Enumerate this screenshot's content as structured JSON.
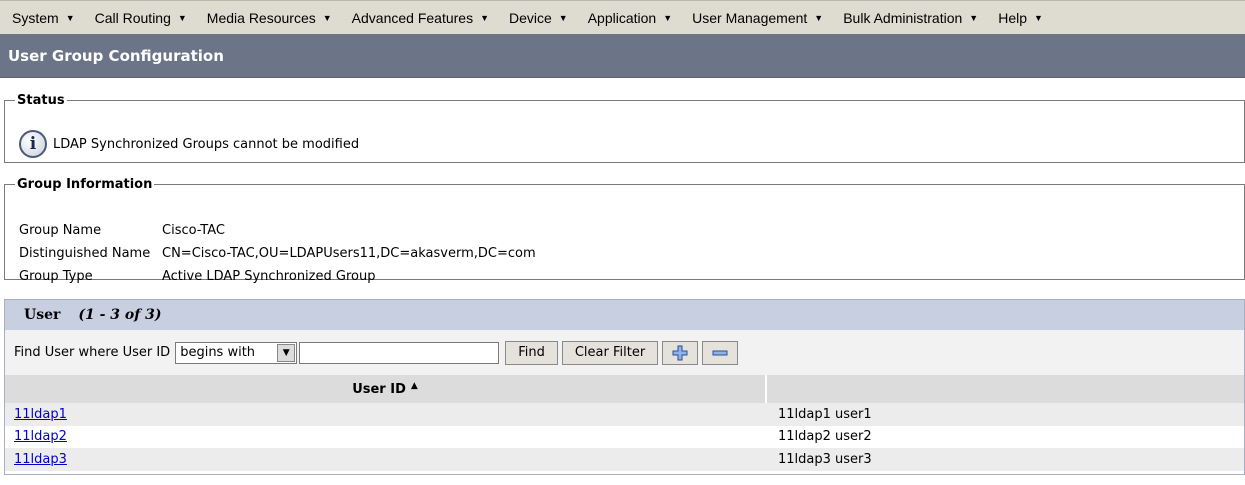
{
  "menu": [
    {
      "label": "System"
    },
    {
      "label": "Call Routing"
    },
    {
      "label": "Media Resources"
    },
    {
      "label": "Advanced Features"
    },
    {
      "label": "Device"
    },
    {
      "label": "Application"
    },
    {
      "label": "User Management"
    },
    {
      "label": "Bulk Administration"
    },
    {
      "label": "Help"
    }
  ],
  "page_title": "User Group Configuration",
  "status": {
    "legend": "Status",
    "icon": "info-icon",
    "message": "LDAP Synchronized Groups cannot be modified"
  },
  "group_info": {
    "legend": "Group Information",
    "rows": [
      {
        "label": "Group Name",
        "value": "Cisco-TAC"
      },
      {
        "label": "Distinguished Name",
        "value": "CN=Cisco-TAC,OU=LDAPUsers11,DC=akasverm,DC=com"
      },
      {
        "label": "Group Type",
        "value": "Active LDAP Synchronized Group"
      }
    ]
  },
  "user_panel": {
    "title": "User",
    "count": "(1 - 3 of 3)",
    "filter_label": "Find User where User ID",
    "filter_select": "begins with",
    "filter_value": "",
    "find_label": "Find",
    "clear_label": "Clear Filter",
    "column_header": "User ID",
    "rows": [
      {
        "user_id": "11ldap1",
        "name": "11ldap1 user1"
      },
      {
        "user_id": "11ldap2",
        "name": "11ldap2 user2"
      },
      {
        "user_id": "11ldap3",
        "name": "11ldap3 user3"
      }
    ]
  },
  "colors": {
    "menubar": "#dedbd0",
    "titlebar": "#6b7587",
    "panel_header": "#c7cfe0",
    "link": "#0000cc"
  }
}
